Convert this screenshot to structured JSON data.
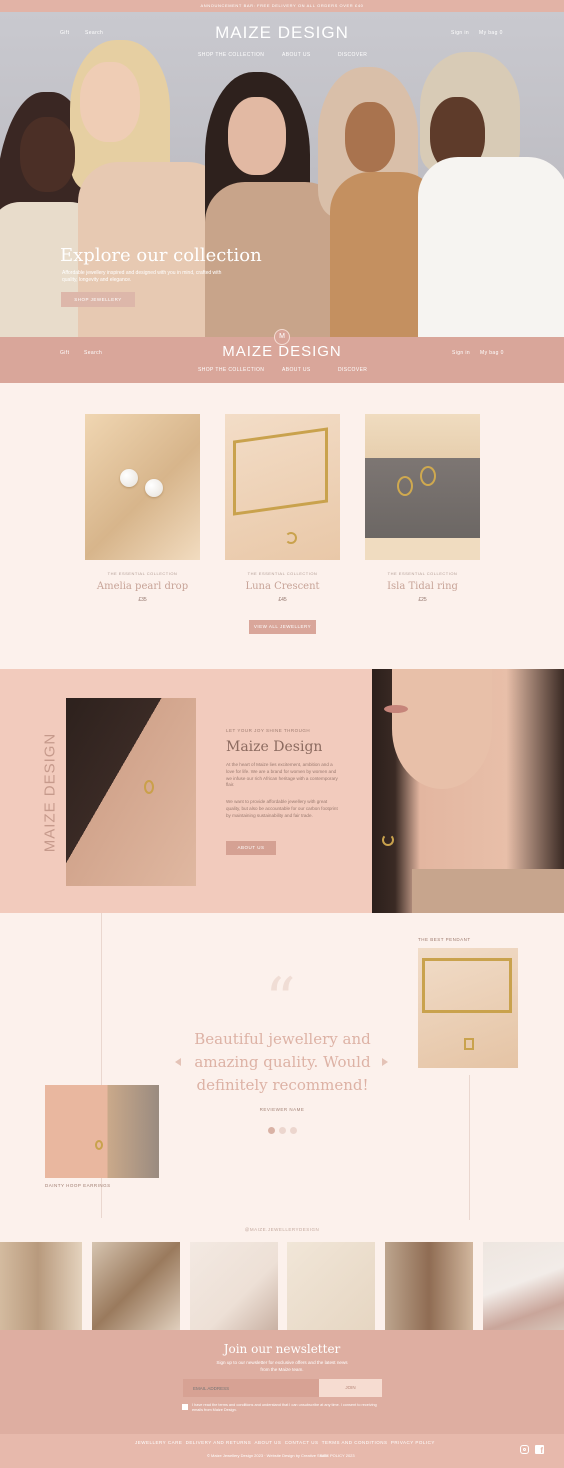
{
  "announcement": "ANNOUNCEMENT BAR: FREE DELIVERY ON ALL ORDERS OVER £40",
  "header": {
    "logo": "MAIZE DESIGN",
    "gift": "Gift",
    "search": "Search",
    "signin": "Sign in",
    "bag": "My bag",
    "bag_count": "0",
    "nav": [
      "SHOP THE COLLECTION",
      "ABOUT US",
      "DISCOVER"
    ]
  },
  "hero": {
    "title": "Explore our collection",
    "text": "Affordable jewellery inspired and designed with you in mind, crafted with quality, longevity and elegance.",
    "button": "SHOP JEWELLERY"
  },
  "sticky": {
    "logo": "MAIZE DESIGN",
    "badge": "M"
  },
  "products": {
    "items": [
      {
        "collection": "THE ESSENTIAL COLLECTION",
        "name": "Amelia pearl drop",
        "price": "£35"
      },
      {
        "collection": "THE ESSENTIAL COLLECTION",
        "name": "Luna Crescent",
        "price": "£45"
      },
      {
        "collection": "THE ESSENTIAL COLLECTION",
        "name": "Isla Tidal ring",
        "price": "£25"
      }
    ],
    "view_all": "VIEW ALL JEWELLERY"
  },
  "about": {
    "vertical": "MAIZE DESIGN",
    "eyebrow": "LET YOUR JOY SHINE THROUGH",
    "title": "Maize Design",
    "p1": "At the heart of Maize lies excitement, ambition and a love for life. We are a brand for women by women and we infuse our rich African heritage with a contemporary flair.",
    "p2": "We want to provide affordable jewellery with great quality, but also be accountable for our carbon footprint by maintaining sustainability and fair trade.",
    "button": "ABOUT US"
  },
  "testimonial": {
    "best_label": "THE BEST PENDANT",
    "quote_mark": "“",
    "quote": "Beautiful jewellery and amazing quality. Would definitely recommend!",
    "reviewer": "REVIEWER NAME",
    "earring_label": "DAINTY HOOP EARRINGS"
  },
  "social": {
    "handle": "@MAIZE.JEWELLERYDESIGN"
  },
  "newsletter": {
    "title": "Join our newsletter",
    "text": "Sign up to our newsletter for exclusive offers and the latest news from the Maize team.",
    "placeholder": "EMAIL ADDRESS",
    "join": "JOIN",
    "consent": "I have read the terms and conditions and understand that I can unsubscribe at any time. I consent to receiving emails from Maize Design."
  },
  "footer": {
    "links": [
      "JEWELLERY CARE",
      "DELIVERY AND RETURNS",
      "ABOUT US",
      "CONTACT US",
      "TERMS AND CONDITIONS",
      "PRIVACY POLICY"
    ],
    "copyright": "© Maize Jewellery Design 2023 · Website Design by Creative Studio",
    "policy": "SITE POLICY 2023"
  },
  "colors": {
    "accent": "#d9a69a",
    "background": "#fcf1ec",
    "about_bg": "#f2cbbd"
  }
}
